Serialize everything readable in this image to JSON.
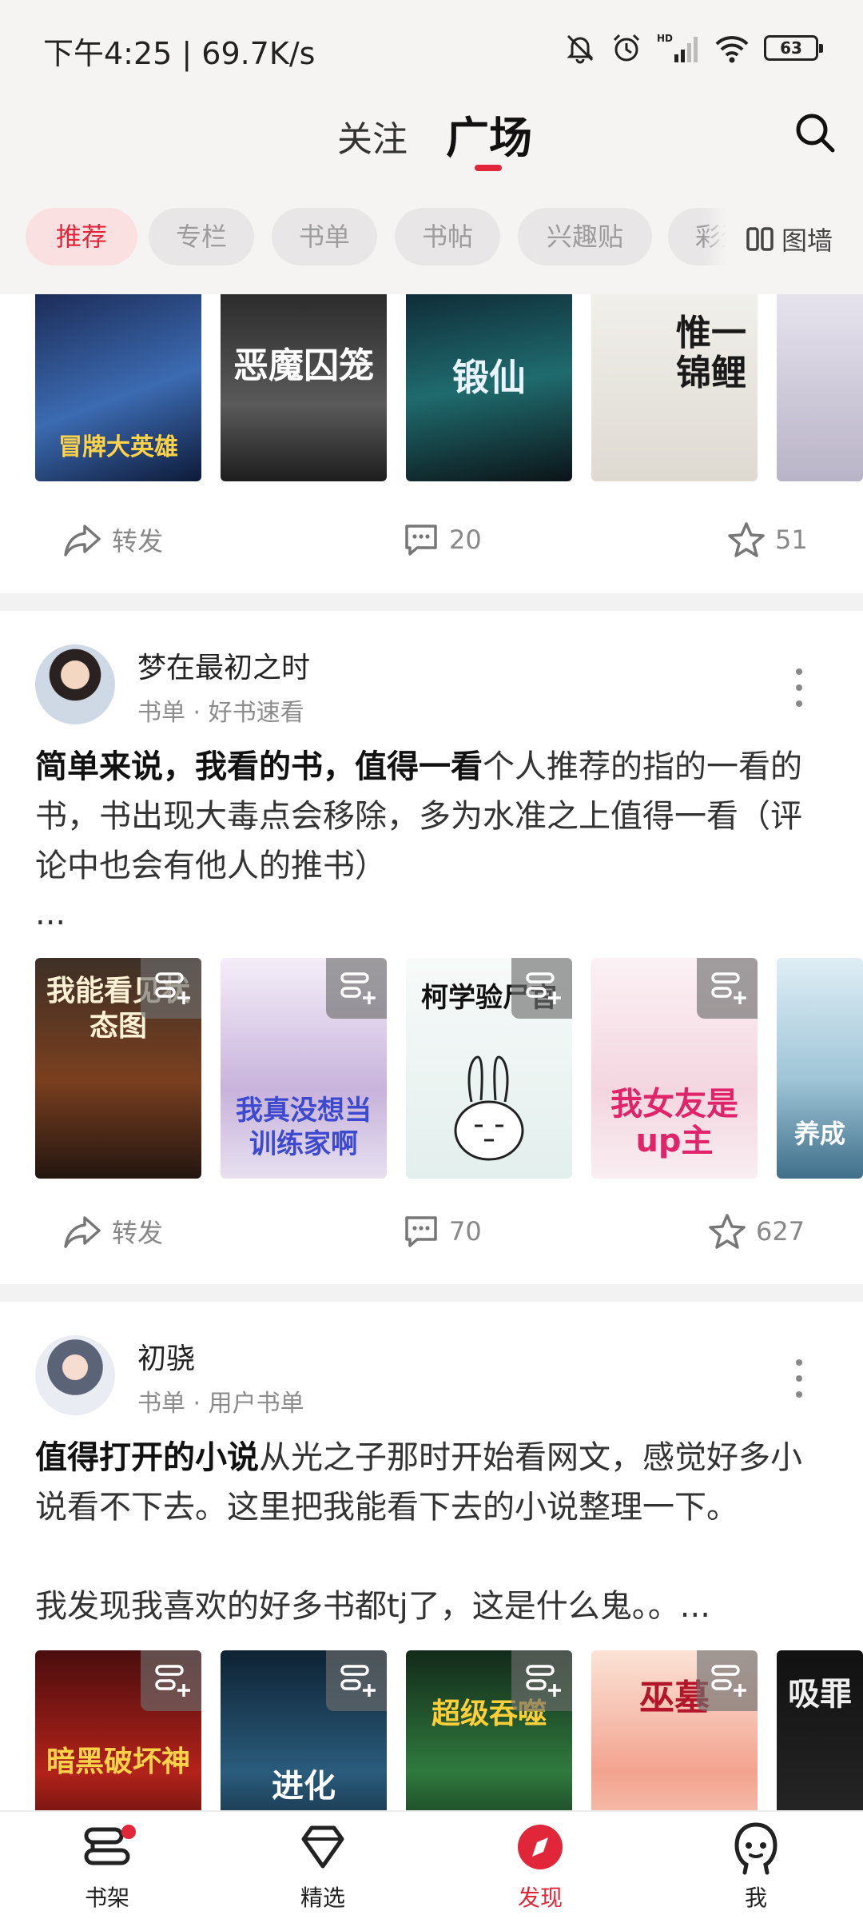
{
  "status_bar": {
    "time": "下午4:25 | 69.7K/s",
    "battery": "63"
  },
  "header": {
    "tabs": [
      {
        "label": "关注",
        "active": false
      },
      {
        "label": "广场",
        "active": true
      }
    ],
    "search_icon": "search-icon"
  },
  "filters": {
    "chips": [
      {
        "label": "推荐",
        "active": true
      },
      {
        "label": "专栏",
        "active": false
      },
      {
        "label": "书单",
        "active": false
      },
      {
        "label": "书帖",
        "active": false
      },
      {
        "label": "兴趣贴",
        "active": false
      },
      {
        "label": "彩蛋",
        "active": false
      }
    ],
    "wall_label": "图墙"
  },
  "posts": [
    {
      "covers": [
        "冒牌大英雄",
        "恶魔囚笼",
        "锻仙",
        "惟一锦鲤",
        ""
      ],
      "actions": {
        "share": "转发",
        "comments": "20",
        "likes": "51"
      }
    },
    {
      "author": "梦在最初之时",
      "meta": "书单 · 好书速看",
      "title": "简单来说，我看的书，值得一看",
      "body": "个人推荐的指的一看的书，书出现大毒点会移除，多为水准之上值得一看（评论中也会有他人的推书）",
      "ellipsis": "...",
      "covers": [
        "我能看见状态图",
        "我真没想当训练家啊",
        "柯学验尸官",
        "我女友是up主",
        "养成"
      ],
      "actions": {
        "share": "转发",
        "comments": "70",
        "likes": "627"
      }
    },
    {
      "author": "初骁",
      "meta": "书单 · 用户书单",
      "title": "值得打开的小说",
      "body": "从光之子那时开始看网文，感觉好多小说看不下去。这里把我能看下去的小说整理一下。",
      "body2": "我发现我喜欢的好多书都tj了，这是什么鬼。。...",
      "covers": [
        "暗黑破坏神",
        "进化",
        "超级吞噬",
        "巫墓",
        "吸罪"
      ]
    }
  ],
  "bottom_nav": [
    {
      "label": "书架",
      "icon": "bookshelf-icon",
      "badge": true,
      "active": false
    },
    {
      "label": "精选",
      "icon": "diamond-icon",
      "badge": false,
      "active": false
    },
    {
      "label": "发现",
      "icon": "compass-icon",
      "badge": false,
      "active": true
    },
    {
      "label": "我",
      "icon": "profile-icon",
      "badge": false,
      "active": false
    }
  ],
  "colors": {
    "accent": "#e2263a",
    "background": "#f6f3f3"
  }
}
